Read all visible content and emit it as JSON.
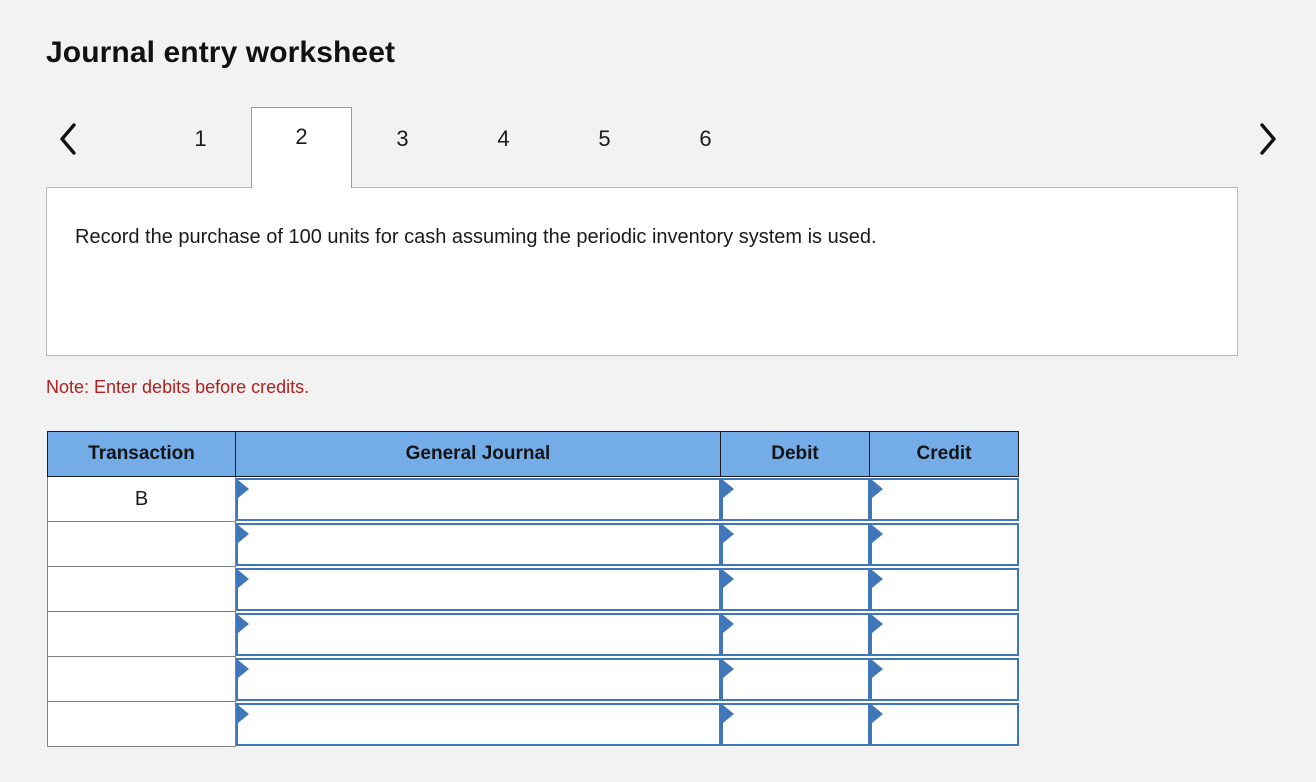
{
  "page_title": "Journal entry worksheet",
  "nav": {
    "prev_icon": "chevron-left-icon",
    "next_icon": "chevron-right-icon",
    "tabs": [
      {
        "label": "1",
        "active": false
      },
      {
        "label": "2",
        "active": true
      },
      {
        "label": "3",
        "active": false
      },
      {
        "label": "4",
        "active": false
      },
      {
        "label": "5",
        "active": false
      },
      {
        "label": "6",
        "active": false
      }
    ]
  },
  "panel": {
    "text": "Record the purchase of 100 units for cash assuming the periodic inventory system is used."
  },
  "note": "Note: Enter debits before credits.",
  "table": {
    "headers": [
      "Transaction",
      "General Journal",
      "Debit",
      "Credit"
    ],
    "rows": [
      {
        "transaction": "B",
        "general_journal": "",
        "debit": "",
        "credit": ""
      },
      {
        "transaction": "",
        "general_journal": "",
        "debit": "",
        "credit": ""
      },
      {
        "transaction": "",
        "general_journal": "",
        "debit": "",
        "credit": ""
      },
      {
        "transaction": "",
        "general_journal": "",
        "debit": "",
        "credit": ""
      },
      {
        "transaction": "",
        "general_journal": "",
        "debit": "",
        "credit": ""
      },
      {
        "transaction": "",
        "general_journal": "",
        "debit": "",
        "credit": ""
      }
    ]
  },
  "colors": {
    "page_background": "#f2f2f2",
    "header_blue": "#74ace8",
    "input_border_blue": "#3f77b8",
    "note_red": "#b02020",
    "grid_gray": "#808080"
  }
}
